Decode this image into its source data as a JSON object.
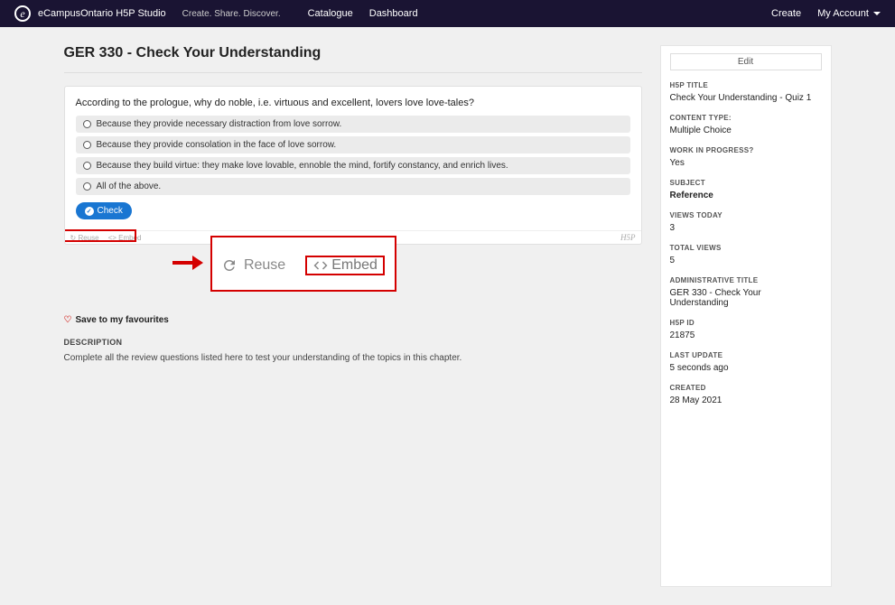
{
  "nav": {
    "brand": "eCampusOntario H5P Studio",
    "tagline": "Create. Share. Discover.",
    "links": {
      "catalogue": "Catalogue",
      "dashboard": "Dashboard"
    },
    "right": {
      "create": "Create",
      "account": "My Account"
    }
  },
  "main": {
    "title": "GER 330 - Check Your Understanding",
    "quiz": {
      "question": "According to the prologue, why do noble, i.e. virtuous and excellent, lovers love love-tales?",
      "options": [
        "Because they provide necessary distraction from love sorrow.",
        "Because they provide consolation in the face of love sorrow.",
        "Because they build virtue: they make love lovable, ennoble the mind, fortify constancy, and enrich lives.",
        "All of the above."
      ],
      "check_label": "Check",
      "reuse_label": "Reuse",
      "embed_label": "Embed",
      "h5p_mark": "H5P"
    },
    "zoom": {
      "reuse": "Reuse",
      "embed": "Embed"
    },
    "save_fav": "Save to my favourites",
    "desc_label": "DESCRIPTION",
    "desc_text": "Complete all the review questions listed here to test your understanding of the topics in this chapter."
  },
  "sidebar": {
    "edit": "Edit",
    "meta": [
      {
        "label": "H5P TITLE",
        "value": "Check Your Understanding - Quiz 1"
      },
      {
        "label": "CONTENT TYPE:",
        "value": "Multiple Choice"
      },
      {
        "label": "WORK IN PROGRESS?",
        "value": "Yes"
      },
      {
        "label": "SUBJECT",
        "value": "Reference",
        "strong": true
      },
      {
        "label": "VIEWS TODAY",
        "value": "3"
      },
      {
        "label": "TOTAL VIEWS",
        "value": "5"
      },
      {
        "label": "ADMINISTRATIVE TITLE",
        "value": "GER 330 - Check Your Understanding"
      },
      {
        "label": "H5P ID",
        "value": "21875"
      },
      {
        "label": "LAST UPDATE",
        "value": "5 seconds ago"
      },
      {
        "label": "CREATED",
        "value": "28 May 2021"
      }
    ]
  }
}
